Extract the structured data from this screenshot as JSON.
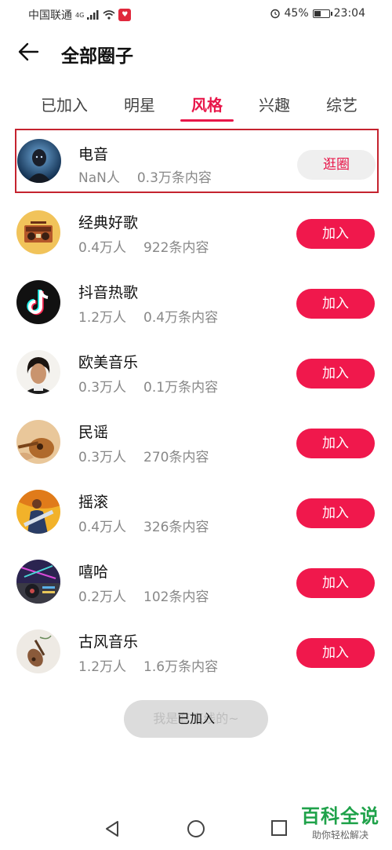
{
  "status_bar": {
    "carrier": "中国联通",
    "network": "4G",
    "battery": "45%",
    "battery_level": 0.45,
    "time": "23:04"
  },
  "header": {
    "title": "全部圈子"
  },
  "tabs": [
    {
      "label": "已加入",
      "active": false
    },
    {
      "label": "明星",
      "active": false
    },
    {
      "label": "风格",
      "active": true
    },
    {
      "label": "兴趣",
      "active": false
    },
    {
      "label": "综艺",
      "active": false
    }
  ],
  "circles": [
    {
      "name": "电音",
      "members": "NaN人",
      "content": "0.3万条内容",
      "button": "逛圈",
      "joined": true
    },
    {
      "name": "经典好歌",
      "members": "0.4万人",
      "content": "922条内容",
      "button": "加入",
      "joined": false
    },
    {
      "name": "抖音热歌",
      "members": "1.2万人",
      "content": "0.4万条内容",
      "button": "加入",
      "joined": false
    },
    {
      "name": "欧美音乐",
      "members": "0.3万人",
      "content": "0.1万条内容",
      "button": "加入",
      "joined": false
    },
    {
      "name": "民谣",
      "members": "0.3万人",
      "content": "270条内容",
      "button": "加入",
      "joined": false
    },
    {
      "name": "摇滚",
      "members": "0.4万人",
      "content": "326条内容",
      "button": "加入",
      "joined": false
    },
    {
      "name": "嘻哈",
      "members": "0.2万人",
      "content": "102条内容",
      "button": "加入",
      "joined": false
    },
    {
      "name": "古风音乐",
      "members": "1.2万人",
      "content": "1.6万条内容",
      "button": "加入",
      "joined": false
    }
  ],
  "footer": {
    "behind_text": "我是有底线的~",
    "toast": "已加入"
  },
  "watermark": {
    "title": "百科全说",
    "subtitle": "助你轻松解决"
  },
  "colors": {
    "accent": "#e8174a",
    "join_button": "#f0184c",
    "highlight_border": "#c5232f"
  }
}
